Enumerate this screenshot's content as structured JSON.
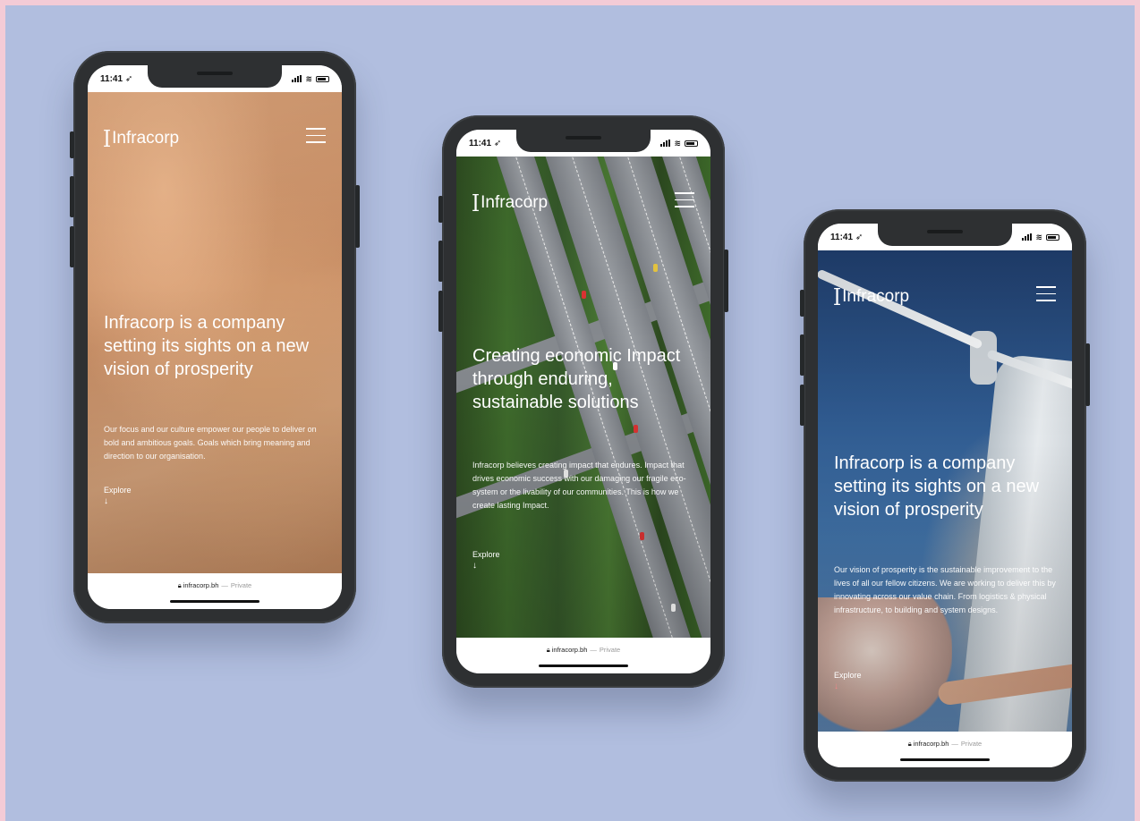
{
  "phones": [
    {
      "status_time": "11:41",
      "brand": "Infracorp",
      "headline": "Infracorp is a company setting its sights on a new vision of prosperity",
      "body": "Our focus and our culture empower our people to deliver on bold and ambitious goals. Goals which bring meaning and direction to our organisation.",
      "cta": "Explore",
      "cta_arrow": "↓",
      "url": "infracorp.bh",
      "url_sep": "—",
      "url_private": "Private",
      "background": "desert-aerial"
    },
    {
      "status_time": "11:41",
      "brand": "Infracorp",
      "headline": "Creating economic Impact through enduring, sustainable solutions",
      "body": "Infracorp believes creating impact that endures. Impact that drives economic success with our damaging our fragile eco-system or the livability of our communities. This is how we create lasting Impact.",
      "cta": "Explore",
      "cta_arrow": "↓",
      "url": "infracorp.bh",
      "url_sep": "—",
      "url_private": "Private",
      "background": "highway-aerial"
    },
    {
      "status_time": "11:41",
      "brand": "Infracorp",
      "headline": "Infracorp is a company setting its sights on a new vision of prosperity",
      "body": "Our vision of prosperity is the sustainable improvement to the lives of all our fellow citizens. We are working to deliver this by innovating across our value chain. From logistics & physical infrastructure, to building and system designs.",
      "cta": "Explore",
      "cta_arrow": "↓",
      "url": "infracorp.bh",
      "url_sep": "—",
      "url_private": "Private",
      "background": "wind-turbine"
    }
  ],
  "icons": {
    "logo": "infracorp-bracket-icon",
    "menu": "hamburger-menu-icon",
    "lock": "lock-icon",
    "location": "location-arrow-icon",
    "wifi": "wifi-icon",
    "battery": "battery-icon"
  },
  "colors": {
    "page_background": "#b1bedf",
    "page_border": "#f4cbd6",
    "phone_frame": "#2e3032",
    "text_on_image": "#ffffff"
  }
}
